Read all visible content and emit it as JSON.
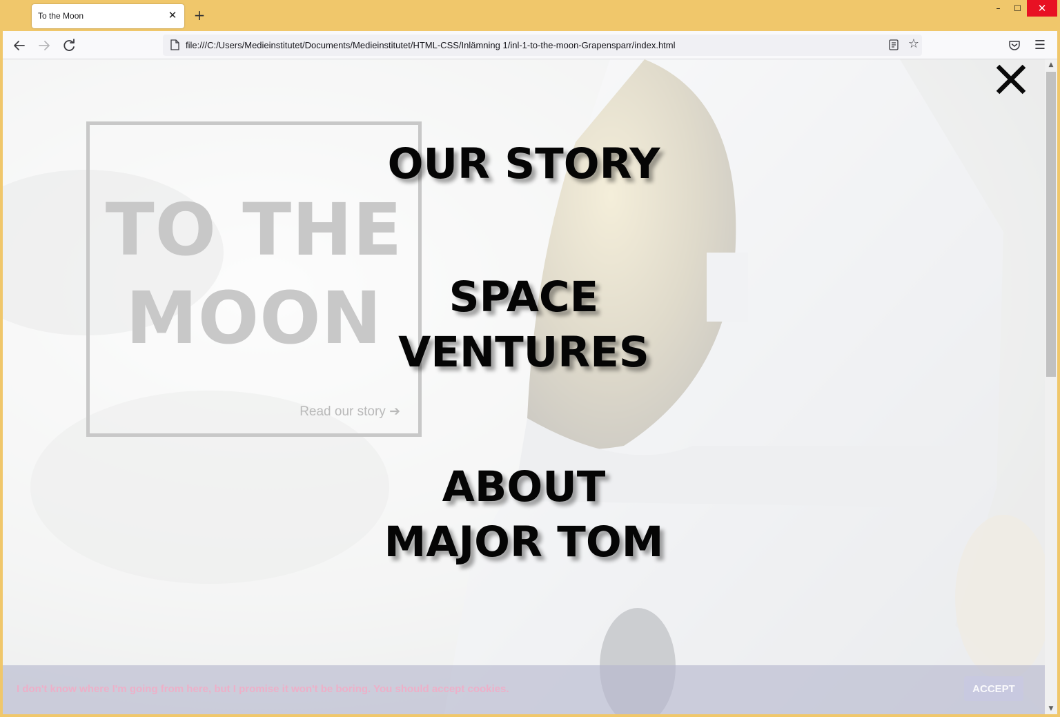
{
  "browser": {
    "tab_title": "To the Moon",
    "tab_close_icon": "close-icon",
    "new_tab_label": "+",
    "url": "file:///C:/Users/Medieinstitutet/Documents/Medieinstitutet/HTML-CSS/Inlämning 1/inl-1-to-the-moon-Grapensparr/index.html",
    "window_controls": {
      "minimize": "–",
      "maximize": "☐",
      "close": "✕"
    },
    "icons": {
      "back": "back-arrow-icon",
      "forward": "forward-arrow-icon",
      "reload": "reload-icon",
      "page": "page-icon",
      "reader": "reader-view-icon",
      "bookmark": "star-icon",
      "pocket": "pocket-icon",
      "menu": "hamburger-menu-icon"
    }
  },
  "page": {
    "hero": {
      "title_line1": "TO THE",
      "title_line2": "MOON",
      "link_label": "Read our story ➔"
    },
    "menu": {
      "close_icon": "close-x-icon",
      "items": [
        {
          "line1": "OUR STORY",
          "line2": ""
        },
        {
          "line1": "SPACE",
          "line2": "VENTURES"
        },
        {
          "line1": "ABOUT",
          "line2": "MAJOR TOM"
        }
      ]
    },
    "cookie": {
      "message": "I don't know where I'm going from here, but I promise it won't be boring. You should accept cookies.",
      "accept_label": "ACCEPT"
    }
  },
  "colors": {
    "browser_frame": "#f0c76b",
    "menu_text": "#050505",
    "hero_text": "#c8c8c8",
    "cookie_text": "#ffa0be"
  }
}
